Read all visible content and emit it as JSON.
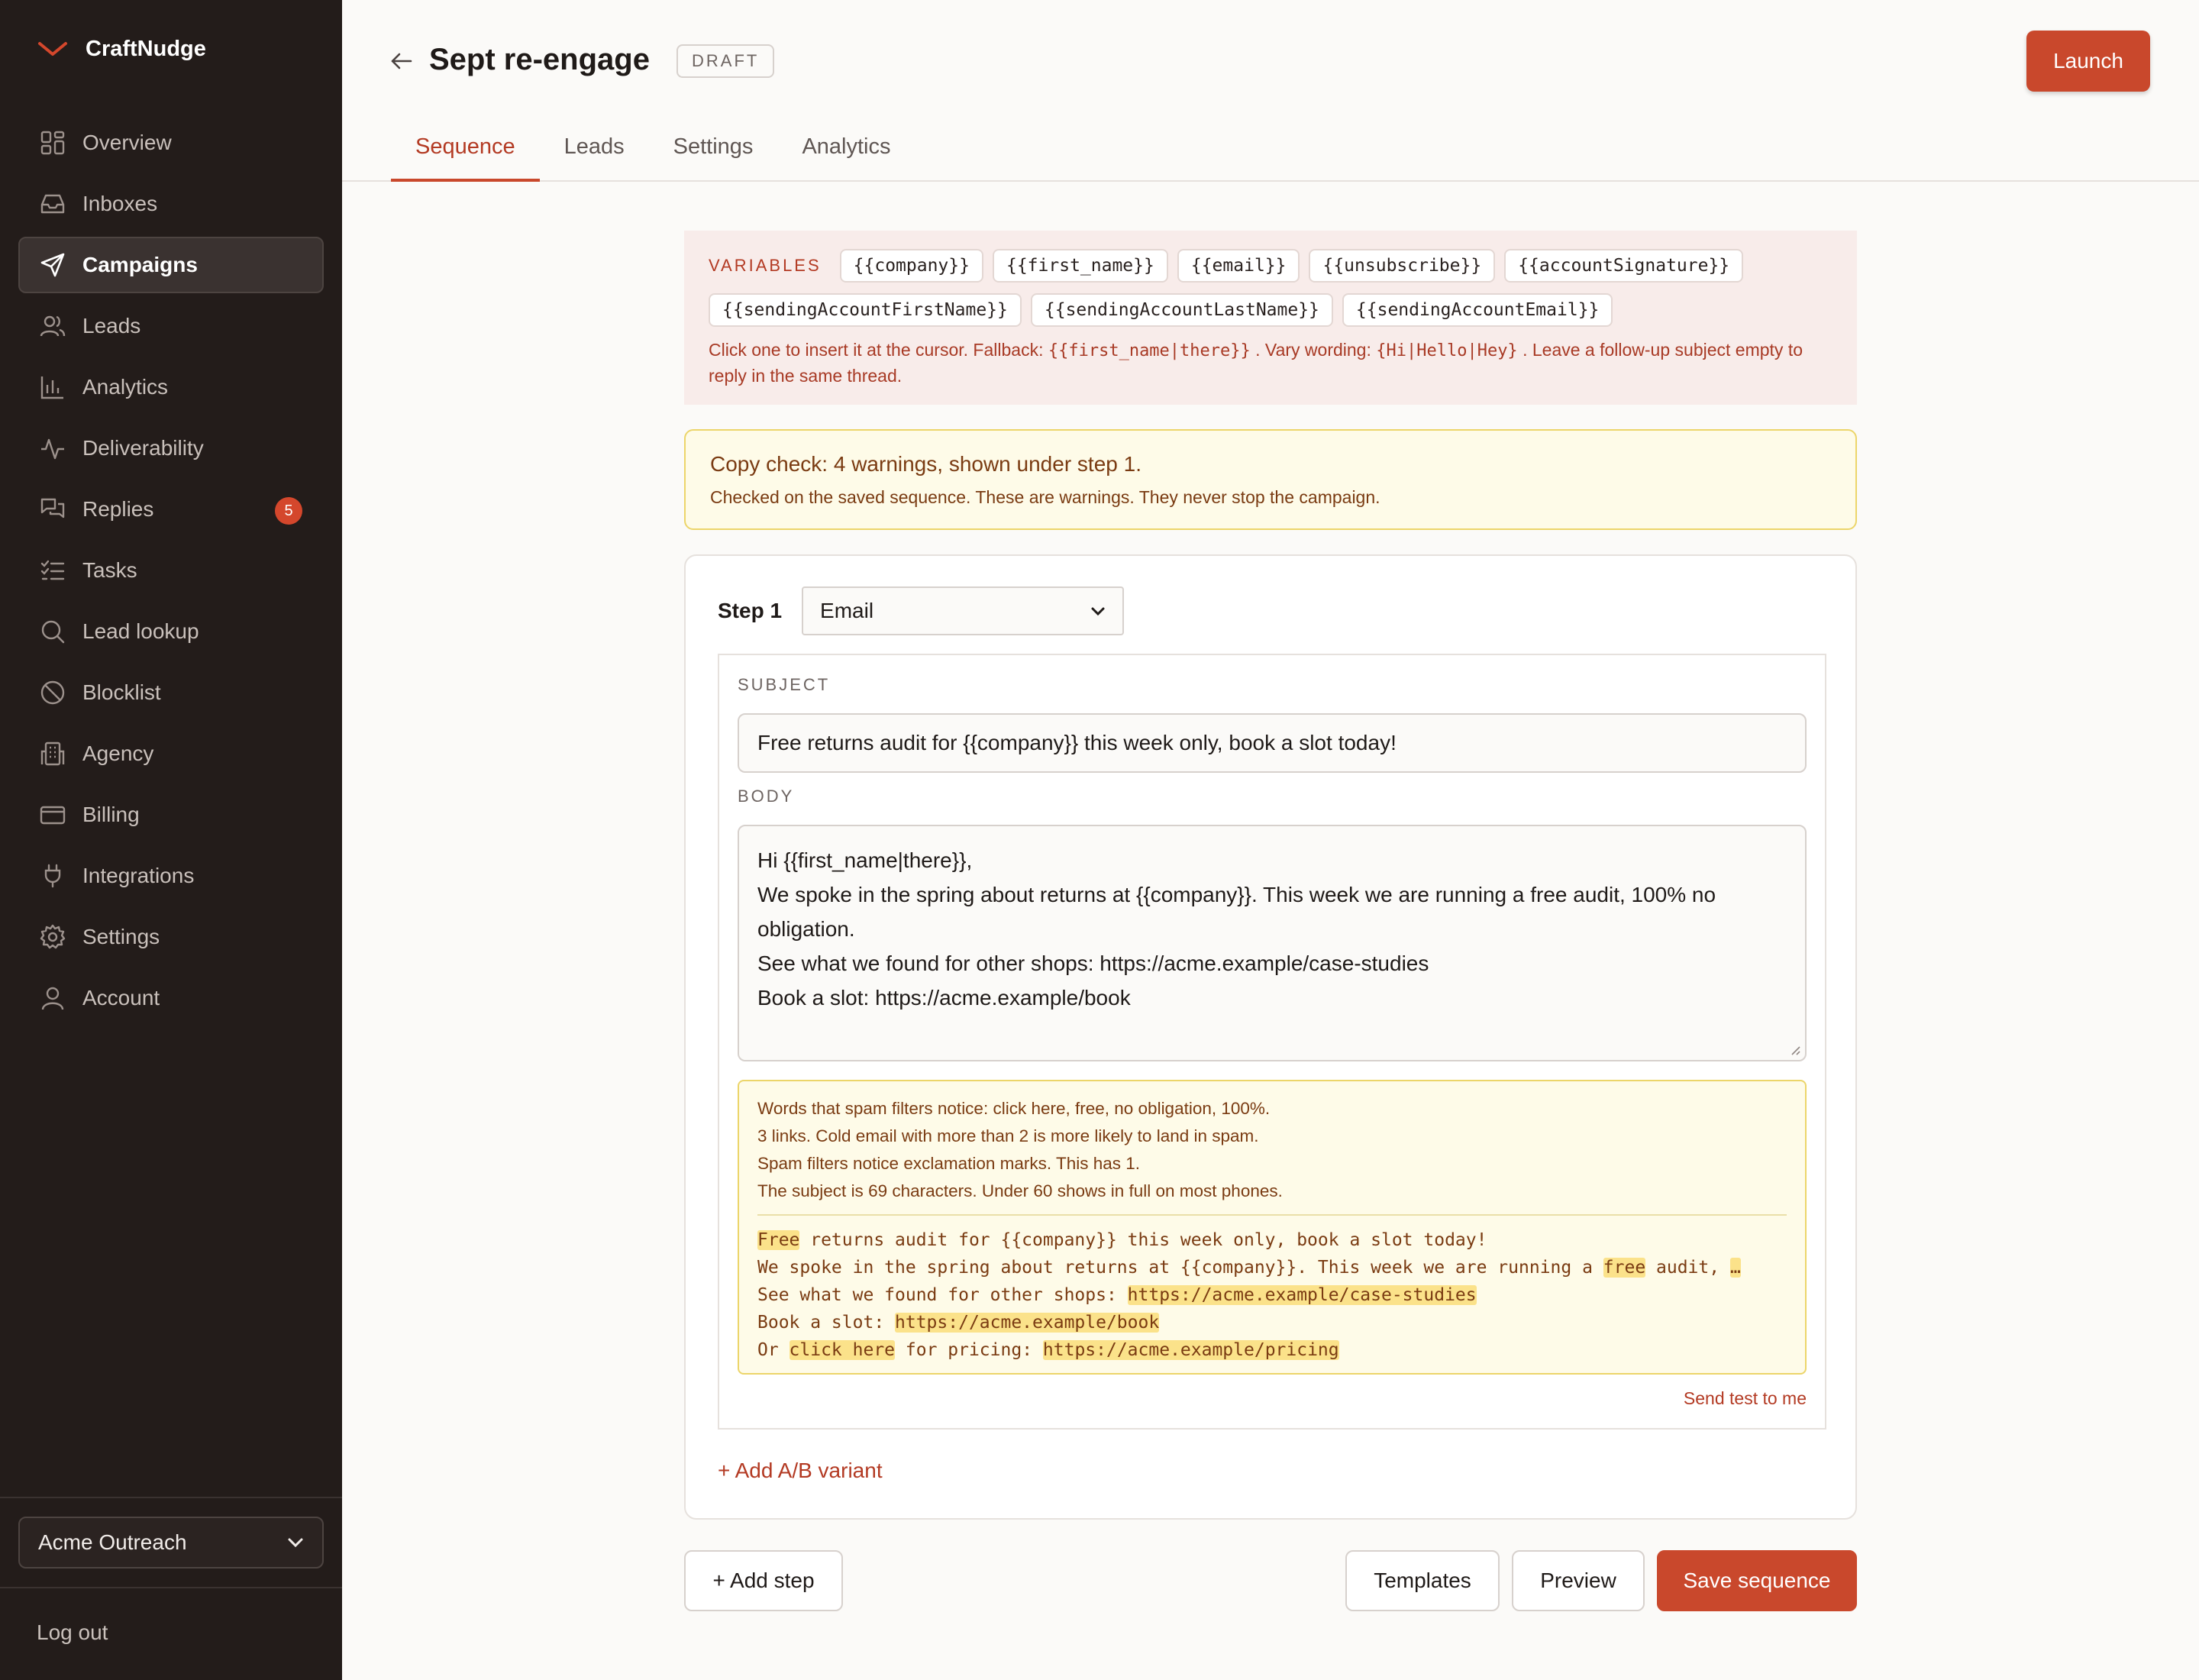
{
  "app": {
    "name": "CraftNudge",
    "brand_color": "#c9482c"
  },
  "sidebar": {
    "items": [
      {
        "label": "Overview",
        "icon": "grid-icon"
      },
      {
        "label": "Inboxes",
        "icon": "inbox-icon"
      },
      {
        "label": "Campaigns",
        "icon": "send-icon",
        "active": true
      },
      {
        "label": "Leads",
        "icon": "users-icon"
      },
      {
        "label": "Analytics",
        "icon": "bar-chart-icon"
      },
      {
        "label": "Deliverability",
        "icon": "activity-icon"
      },
      {
        "label": "Replies",
        "icon": "messages-icon",
        "badge": "5"
      },
      {
        "label": "Tasks",
        "icon": "checklist-icon"
      },
      {
        "label": "Lead lookup",
        "icon": "search-icon"
      },
      {
        "label": "Blocklist",
        "icon": "ban-icon"
      },
      {
        "label": "Agency",
        "icon": "building-icon"
      },
      {
        "label": "Billing",
        "icon": "credit-card-icon"
      },
      {
        "label": "Integrations",
        "icon": "plug-icon"
      },
      {
        "label": "Settings",
        "icon": "gear-icon"
      },
      {
        "label": "Account",
        "icon": "user-icon"
      }
    ],
    "workspace": "Acme Outreach",
    "logout": "Log out"
  },
  "header": {
    "title": "Sept re-engage",
    "status": "DRAFT",
    "launch": "Launch",
    "tabs": [
      "Sequence",
      "Leads",
      "Settings",
      "Analytics"
    ],
    "active_tab": "Sequence"
  },
  "variables": {
    "label": "VARIABLES",
    "row1": [
      "{{company}}",
      "{{first_name}}",
      "{{email}}",
      "{{unsubscribe}}",
      "{{accountSignature}}"
    ],
    "row2": [
      "{{sendingAccountFirstName}}",
      "{{sendingAccountLastName}}",
      "{{sendingAccountEmail}}"
    ],
    "help_1": "Click one to insert it at the cursor. Fallback:",
    "help_code_1": "{{first_name|there}}",
    "help_2": ". Vary wording:",
    "help_code_2": "{Hi|Hello|Hey}",
    "help_3": ". Leave a follow-up subject empty to reply in the same thread."
  },
  "copy_check": {
    "title": "Copy check: 4 warnings, shown under step 1.",
    "subtitle": "Checked on the saved sequence. These are warnings. They never stop the campaign."
  },
  "step": {
    "label": "Step 1",
    "type": "Email",
    "subject_label": "SUBJECT",
    "subject": "Free returns audit for {{company}} this week only, book a slot today!",
    "body_label": "BODY",
    "body_lines": [
      "Hi {{first_name|there}},",
      "",
      "We spoke in the spring about returns at {{company}}. This week we are running a free audit, 100% no obligation.",
      "",
      "See what we found for other shops: https://acme.example/case-studies",
      "Book a slot: https://acme.example/book"
    ],
    "warnings": [
      "Words that spam filters notice: click here, free, no obligation, 100%.",
      "3 links. Cold email with more than 2 is more likely to land in spam.",
      "Spam filters notice exclamation marks. This has 1.",
      "The subject is 69 characters. Under 60 shows in full on most phones."
    ],
    "preview": {
      "l1_hl": "Free",
      "l1_rest": " returns audit for {{company}} this week only, book a slot today!",
      "l2_a": "We spoke in the spring about returns at {{company}}. This week we are running a ",
      "l2_hl": "free",
      "l2_b": " audit, ",
      "l2_more": "…",
      "l3_a": "See what we found for other shops: ",
      "l3_hl": "https://acme.example/case-studies",
      "l4_a": "Book a slot: ",
      "l4_hl": "https://acme.example/book",
      "l5_a": "Or ",
      "l5_hl1": "click here",
      "l5_b": " for pricing: ",
      "l5_hl2": "https://acme.example/pricing"
    },
    "send_test": "Send test to me",
    "add_variant": "+ Add A/B variant"
  },
  "footer": {
    "add_step": "+ Add step",
    "templates": "Templates",
    "preview": "Preview",
    "save": "Save sequence"
  }
}
